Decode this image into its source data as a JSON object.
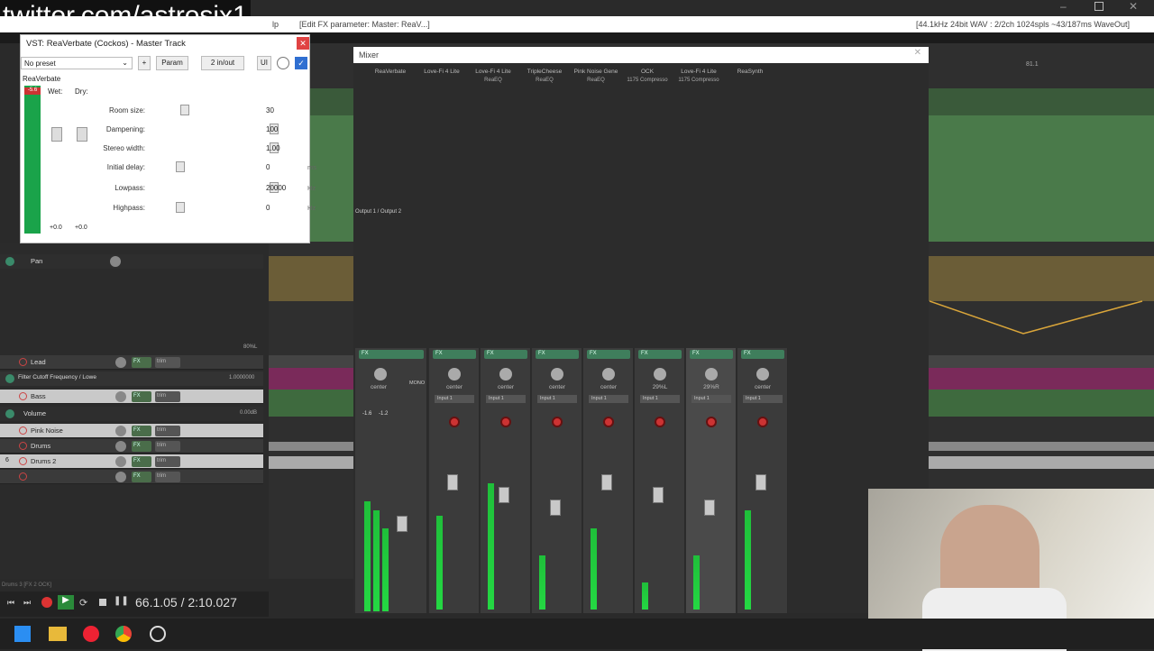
{
  "watermark": "twitter.com/astrosix1",
  "titlebar": {
    "left_text": "lp",
    "center_text": "[Edit FX parameter: Master: ReaV...]",
    "right_text": "[44.1kHz 24bit WAV : 2/2ch 1024spls ~43/187ms WaveOut]"
  },
  "fx_window": {
    "title": "VST: ReaVerbate (Cockos) - Master Track",
    "preset": "No preset",
    "plus": "+",
    "param_label": "Param",
    "io_label": "2 in/out",
    "ui_label": "UI",
    "plugin_name": "ReaVerbate",
    "meter_value": "-5.6",
    "wet_label": "Wet:",
    "dry_label": "Dry:",
    "wet_value": "+0.0",
    "dry_value": "+0.0",
    "params": [
      {
        "label": "Room size:",
        "value": "30",
        "unit": "",
        "level": 0.05
      },
      {
        "label": "Dampening:",
        "value": "100",
        "unit": "",
        "level": 1.0
      },
      {
        "label": "Stereo width:",
        "value": "1.00",
        "unit": "",
        "level": 1.0
      },
      {
        "label": "Initial delay:",
        "value": "0",
        "unit": "ms",
        "level": 0.0
      },
      {
        "label": "Lowpass:",
        "value": "20000",
        "unit": "Hz",
        "level": 1.0
      },
      {
        "label": "Highpass:",
        "value": "0",
        "unit": "Hz",
        "level": 0.0
      }
    ]
  },
  "tracks": {
    "pan_env": "Pan",
    "items": [
      {
        "name": "Lead",
        "fx": "FX",
        "trim": "trim"
      },
      {
        "name": "Filter Cutoff Frequency / Lowe",
        "fx": "",
        "trim": ""
      },
      {
        "name": "Bass",
        "fx": "FX",
        "trim": "trim"
      },
      {
        "name": "Volume",
        "fx": "",
        "trim": ""
      },
      {
        "name": "Pink Noise",
        "fx": "FX",
        "trim": "trim"
      },
      {
        "name": "Drums",
        "fx": "FX",
        "trim": "trim"
      },
      {
        "name": "Drums 2",
        "fx": "FX",
        "trim": "trim"
      },
      {
        "name": "",
        "fx": "FX",
        "trim": "trim"
      }
    ],
    "track_number": "6",
    "db_labels": [
      "80%L",
      "1.0000000",
      "0.00dB"
    ]
  },
  "mixer": {
    "title": "Mixer",
    "output_label": "Output 1 / Output 2",
    "plugins": [
      {
        "name": "ReaVerbate",
        "sub": ""
      },
      {
        "name": "Love-Fi 4 Lite",
        "sub": ""
      },
      {
        "name": "Love-Fi 4 Lite",
        "sub": "ReaEQ"
      },
      {
        "name": "TripleCheese",
        "sub": "ReaEQ"
      },
      {
        "name": "Pink Noise Gene",
        "sub": "ReaEQ"
      },
      {
        "name": "OCK",
        "sub": "1175 Compresso"
      },
      {
        "name": "Love-Fi 4 Lite",
        "sub": "1175 Compresso"
      },
      {
        "name": "ReaSynth",
        "sub": ""
      }
    ],
    "master_pan": "center",
    "master_mono": "MONO",
    "master_levels": [
      "-1.6",
      "-1.2"
    ],
    "strips": [
      {
        "pan": "center",
        "input": "Input 1"
      },
      {
        "pan": "center",
        "input": "Input 1"
      },
      {
        "pan": "center",
        "input": "Input 1"
      },
      {
        "pan": "center",
        "input": "Input 1"
      },
      {
        "pan": "29%L",
        "input": "Input 1"
      },
      {
        "pan": "29%R",
        "input": "Input 1"
      },
      {
        "pan": "center",
        "input": "Input 1"
      }
    ],
    "fx_label": "FX"
  },
  "ruler_value": "81.1",
  "transport": {
    "time": "66.1.05 / 2:10.027",
    "status": "Drums 3 [FX 2 OCK]"
  }
}
